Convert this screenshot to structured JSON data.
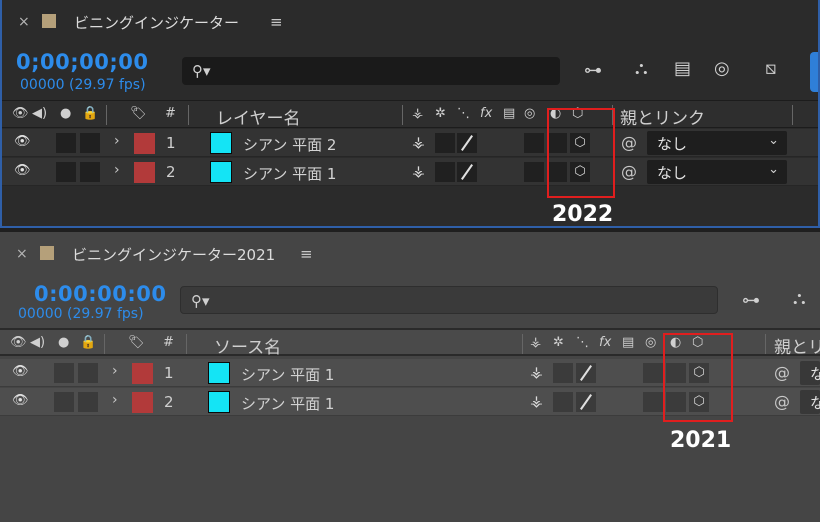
{
  "panel_2022": {
    "tab_close": "×",
    "tab_title": "ビニングインジケーター",
    "tab_menu": "≡",
    "timecode": "0;00;00;00",
    "frames": "00000 (29.97 fps)",
    "search_icon": "⚲▾",
    "header": {
      "name_col": "レイヤー名",
      "fx": "fx",
      "parent_col": "親とリンク",
      "hash": "#"
    },
    "rows": [
      {
        "num": "1",
        "name": "シアン 平面 2",
        "parent": "なし"
      },
      {
        "num": "2",
        "name": "シアン 平面 1",
        "parent": "なし"
      }
    ],
    "annotation": "2022"
  },
  "panel_2021": {
    "tab_close": "×",
    "tab_title": "ビニングインジケーター2021",
    "tab_menu": "≡",
    "timecode": "0:00:00:00",
    "frames": "00000 (29.97 fps)",
    "search_icon": "⚲▾",
    "header": {
      "name_col": "ソース名",
      "fx": "fx",
      "parent_col": "親とリ",
      "hash": "#"
    },
    "rows": [
      {
        "num": "1",
        "name": "シアン 平面 1",
        "parent": "な"
      },
      {
        "num": "2",
        "name": "シアン 平面 1",
        "parent": "な"
      }
    ],
    "annotation": "2021"
  },
  "colors": {
    "timecode": "#2d8ceb",
    "solid": "#14e4f5",
    "label": "#b23a3a",
    "annotation": "#e01e1e",
    "panel_border": "#2f5fa8"
  }
}
